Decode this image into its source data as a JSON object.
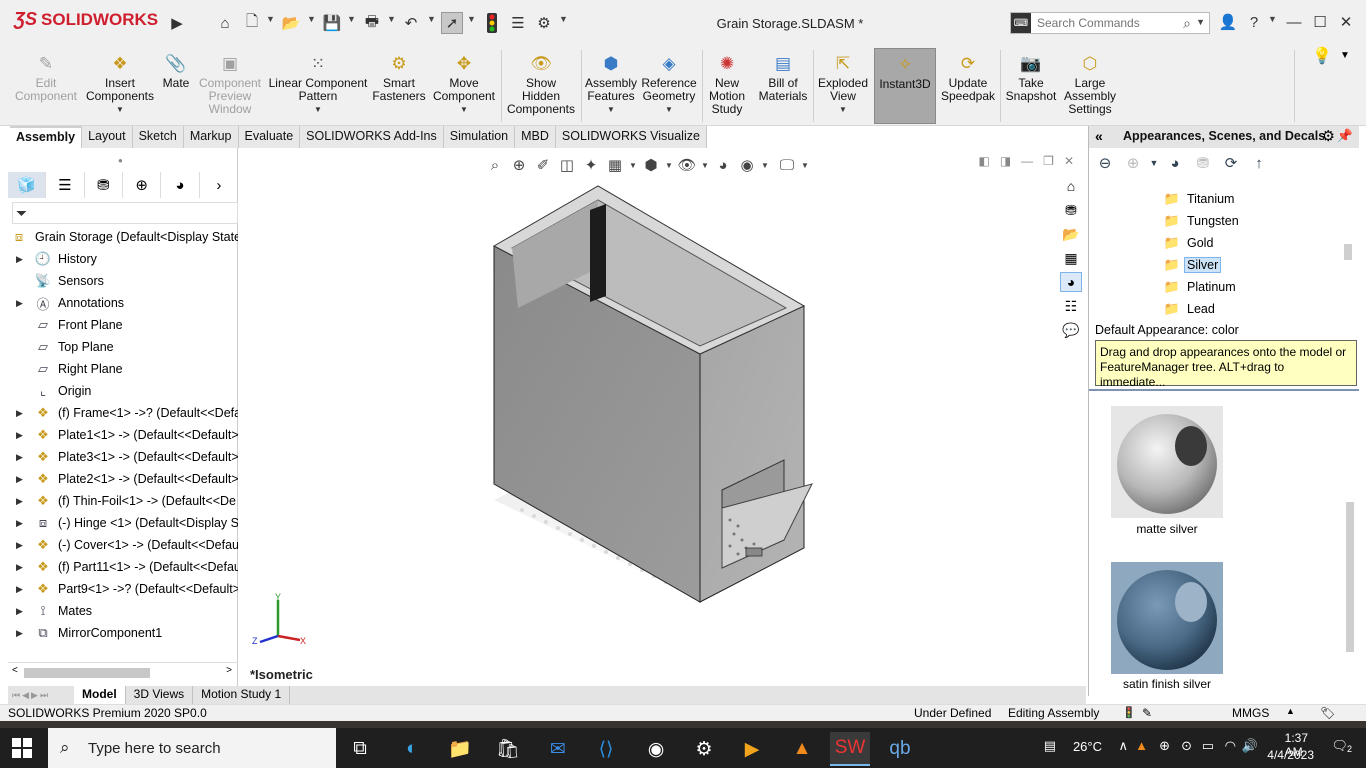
{
  "app": {
    "brand": "SOLIDWORKS",
    "document_title": "Grain Storage.SLDASM *",
    "search_placeholder": "Search Commands"
  },
  "ribbon": {
    "buttons": [
      {
        "label": "Edit Component",
        "icon": "edit-component-icon",
        "disabled": true
      },
      {
        "label": "Insert Components",
        "icon": "insert-components-icon"
      },
      {
        "label": "Mate",
        "icon": "paperclip-icon"
      },
      {
        "label": "Component Preview Window",
        "icon": "component-preview-icon",
        "disabled": true
      },
      {
        "label": "Linear Component Pattern",
        "icon": "linear-pattern-icon"
      },
      {
        "label": "Smart Fasteners",
        "icon": "smart-fasteners-icon"
      },
      {
        "label": "Move Component",
        "icon": "move-component-icon"
      },
      {
        "label": "Show Hidden Components",
        "icon": "show-hidden-icon"
      },
      {
        "label": "Assembly Features",
        "icon": "assembly-features-icon"
      },
      {
        "label": "Reference Geometry",
        "icon": "reference-geometry-icon"
      },
      {
        "label": "New Motion Study",
        "icon": "motion-study-icon"
      },
      {
        "label": "Bill of Materials",
        "icon": "bom-icon"
      },
      {
        "label": "Exploded View",
        "icon": "exploded-view-icon"
      },
      {
        "label": "Instant3D",
        "icon": "instant3d-icon",
        "active": true
      },
      {
        "label": "Update Speedpak",
        "icon": "speedpak-icon"
      },
      {
        "label": "Take Snapshot",
        "icon": "camera-icon"
      },
      {
        "label": "Large Assembly Settings",
        "icon": "large-assembly-icon"
      }
    ]
  },
  "tabs": [
    "Assembly",
    "Layout",
    "Sketch",
    "Markup",
    "Evaluate",
    "SOLIDWORKS Add-Ins",
    "Simulation",
    "MBD",
    "SOLIDWORKS Visualize"
  ],
  "tree": {
    "root": "Grain Storage  (Default<Display State-",
    "items": [
      {
        "label": "History",
        "expandable": true,
        "icon": "history-icon"
      },
      {
        "label": "Sensors",
        "expandable": false,
        "icon": "sensors-icon"
      },
      {
        "label": "Annotations",
        "expandable": true,
        "icon": "annotations-icon"
      },
      {
        "label": "Front Plane",
        "expandable": false,
        "icon": "plane-icon"
      },
      {
        "label": "Top Plane",
        "expandable": false,
        "icon": "plane-icon"
      },
      {
        "label": "Right Plane",
        "expandable": false,
        "icon": "plane-icon"
      },
      {
        "label": "Origin",
        "expandable": false,
        "icon": "origin-icon"
      },
      {
        "label": "(f) Frame<1> ->? (Default<<Defa",
        "expandable": true,
        "icon": "part-icon"
      },
      {
        "label": "Plate1<1> -> (Default<<Default>",
        "expandable": true,
        "icon": "part-icon"
      },
      {
        "label": "Plate3<1> -> (Default<<Default>",
        "expandable": true,
        "icon": "part-icon"
      },
      {
        "label": "Plate2<1> -> (Default<<Default>",
        "expandable": true,
        "icon": "part-icon"
      },
      {
        "label": "(f) Thin-Foil<1> -> (Default<<De",
        "expandable": true,
        "icon": "part-icon"
      },
      {
        "label": "(-) Hinge <1> (Default<Display St",
        "expandable": true,
        "icon": "subassembly-icon"
      },
      {
        "label": "(-) Cover<1> -> (Default<<Defau",
        "expandable": true,
        "icon": "part-icon"
      },
      {
        "label": "(f) Part11<1> -> (Default<<Defau",
        "expandable": true,
        "icon": "part-icon"
      },
      {
        "label": "Part9<1> ->? (Default<<Default>",
        "expandable": true,
        "icon": "part-icon"
      },
      {
        "label": "Mates",
        "expandable": true,
        "icon": "mates-icon"
      },
      {
        "label": "MirrorComponent1",
        "expandable": true,
        "icon": "mirror-icon"
      }
    ]
  },
  "viewport": {
    "view_label": "*Isometric"
  },
  "appearances": {
    "title": "Appearances, Scenes, and Decals",
    "materials": [
      "Titanium",
      "Tungsten",
      "Gold",
      "Silver",
      "Platinum",
      "Lead"
    ],
    "selected": "Silver",
    "default_label": "Default Appearance: color",
    "tooltip": "Drag and drop appearances onto the model or FeatureManager tree.  ALT+drag to immediate...",
    "swatches": [
      {
        "label": "matte silver",
        "color": "#b8b8b8"
      },
      {
        "label": "satin finish silver",
        "color": "#4a6a86"
      }
    ]
  },
  "bottom_tabs": [
    "Model",
    "3D Views",
    "Motion Study 1"
  ],
  "status": {
    "product": "SOLIDWORKS Premium 2020 SP0.0",
    "state": "Under Defined",
    "mode": "Editing Assembly",
    "units": "MMGS"
  },
  "taskbar": {
    "search_placeholder": "Type here to search",
    "weather": "26°C",
    "time": "1:37 AM",
    "date": "4/4/2023",
    "notifications": "2"
  }
}
